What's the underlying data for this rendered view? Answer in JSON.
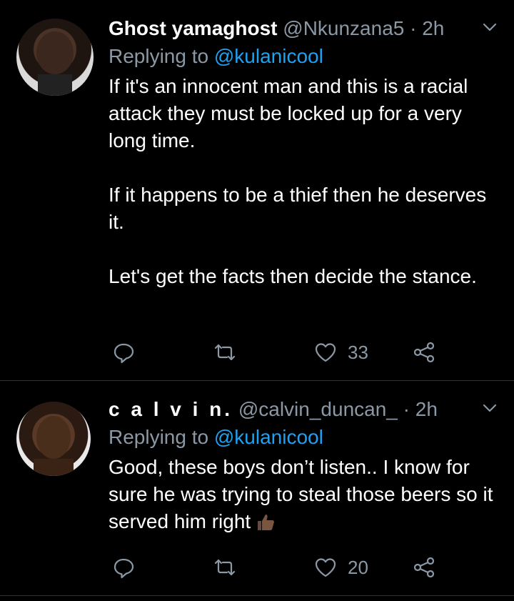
{
  "tweets": [
    {
      "display_name": "Ghost yamaghost",
      "handle": "@Nkunzana5",
      "time": "· 2h",
      "replying_prefix": "Replying to ",
      "replying_to": "@kulanicool",
      "paragraphs": [
        "If it's an innocent man and this is a racial attack they must be locked up for a very long time.",
        "If it happens to be a thief then he deserves it.",
        "Let's get the facts then decide the stance."
      ],
      "like_count": "33"
    },
    {
      "display_name": "c a l v i n.",
      "handle": "@calvin_duncan_",
      "time": "· 2h",
      "replying_prefix": "Replying to ",
      "replying_to": "@kulanicool",
      "paragraphs": [
        "Good, these boys don’t listen.. I know for sure he was trying to steal those beers so it served him right"
      ],
      "emoji": "thumbs-up-dark-skin",
      "like_count": "20"
    }
  ],
  "colors": {
    "background": "#000000",
    "text": "#ffffff",
    "muted": "#8b98a5",
    "link": "#1da1f2",
    "divider": "#2f3336"
  }
}
